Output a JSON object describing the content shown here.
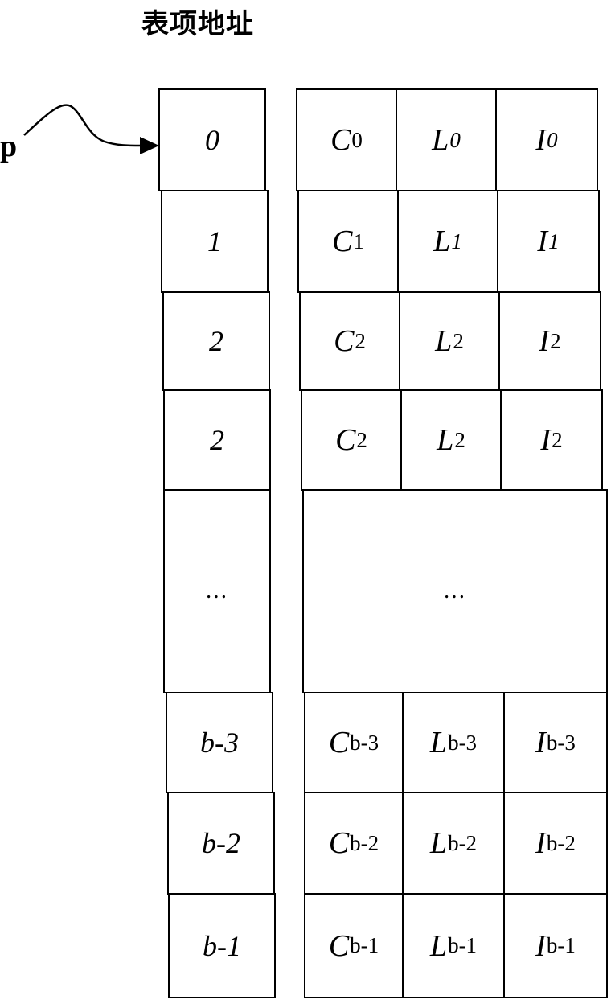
{
  "title": "表项地址",
  "pointer": {
    "label": "p",
    "target_index": 0
  },
  "address_column": [
    {
      "label": "0"
    },
    {
      "label": "1"
    },
    {
      "label": "2"
    },
    {
      "label": "2"
    },
    {
      "label": "..."
    },
    {
      "label": "b-3"
    },
    {
      "label": "b-2"
    },
    {
      "label": "b-1"
    }
  ],
  "entries": [
    {
      "cells": [
        {
          "base": "C",
          "sub": "0",
          "sub_style": "upright"
        },
        {
          "base": "L",
          "sub": "0",
          "sub_style": "italic"
        },
        {
          "base": "I",
          "sub": "0",
          "sub_style": "italic"
        }
      ]
    },
    {
      "cells": [
        {
          "base": "C",
          "sub": "1",
          "sub_style": "upright"
        },
        {
          "base": "L",
          "sub": "1",
          "sub_style": "italic"
        },
        {
          "base": "I",
          "sub": "1",
          "sub_style": "italic"
        }
      ]
    },
    {
      "cells": [
        {
          "base": "C",
          "sub": "2",
          "sub_style": "upright"
        },
        {
          "base": "L",
          "sub": "2",
          "sub_style": "upright"
        },
        {
          "base": "I",
          "sub": "2",
          "sub_style": "upright"
        }
      ]
    },
    {
      "cells": [
        {
          "base": "C",
          "sub": "2",
          "sub_style": "upright"
        },
        {
          "base": "L",
          "sub": "2",
          "sub_style": "upright"
        },
        {
          "base": "I",
          "sub": "2",
          "sub_style": "upright"
        }
      ]
    },
    {
      "ellipsis": "..."
    },
    {
      "cells": [
        {
          "base": "C",
          "sub": "b-3",
          "sub_style": "upright"
        },
        {
          "base": "L",
          "sub": "b-3",
          "sub_style": "upright"
        },
        {
          "base": "I",
          "sub": "b-3",
          "sub_style": "upright"
        }
      ]
    },
    {
      "cells": [
        {
          "base": "C",
          "sub": "b-2",
          "sub_style": "upright"
        },
        {
          "base": "L",
          "sub": "b-2",
          "sub_style": "upright"
        },
        {
          "base": "I",
          "sub": "b-2",
          "sub_style": "upright"
        }
      ]
    },
    {
      "cells": [
        {
          "base": "C",
          "sub": "b-1",
          "sub_style": "upright"
        },
        {
          "base": "L",
          "sub": "b-1",
          "sub_style": "upright"
        },
        {
          "base": "I",
          "sub": "b-1",
          "sub_style": "upright"
        }
      ]
    }
  ]
}
